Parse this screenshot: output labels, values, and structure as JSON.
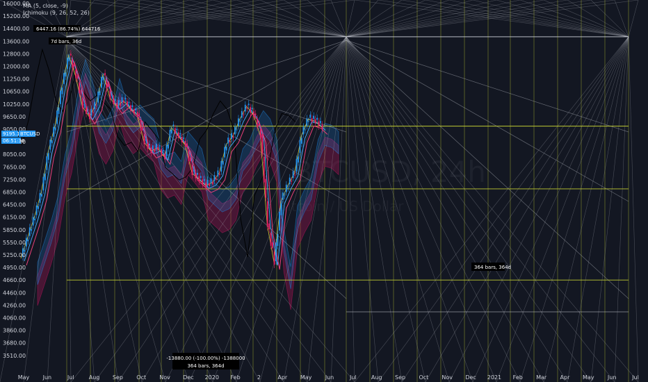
{
  "legend": {
    "ma": "MA (5, close, -9)",
    "ichimoku": "Ichimoku (9, 26, 52, 26)"
  },
  "watermark": {
    "symbol": "BTCUSD, 24h",
    "desc": "Bitcoin / US Dollar"
  },
  "price_tags": {
    "last_price": "9195.12",
    "exchange": "BTCUSD",
    "countdown": "06:51:36"
  },
  "annotations": {
    "top_label": "6447.16 (86.74%) 644716",
    "top_bars": "7d bars, 36d",
    "mid_bars": "364 bars, 364d",
    "bottom_pct": "-13880.00 (-100.00%) -1388000",
    "bottom_bars": "364 bars, 364d"
  },
  "colors": {
    "background": "#131722",
    "candle_up": "#2196f3",
    "candle_down": "#e91e63",
    "ma_line": "#000000",
    "tenkan": "#42a5f5",
    "kijun": "#ec407a",
    "lagging": "#ffeb3b",
    "cloud_bull": "#1e88e5",
    "cloud_bear": "#ad1457",
    "gann_lines": "#b2b5be",
    "fib_lines": "#c0ca33",
    "last_price_tag": "#2196f3"
  },
  "chart_data": {
    "type": "candlestick",
    "title": "",
    "xlabel": "",
    "ylabel": "",
    "x_ticks": [
      "May",
      "Jun",
      "Jul",
      "Aug",
      "Sep",
      "Oct",
      "Nov",
      "Dec",
      "2020",
      "Feb",
      "2",
      "Apr",
      "May",
      "Jun",
      "Jul",
      "Aug",
      "Sep",
      "Oct",
      "Nov",
      "Dec",
      "2021",
      "Feb",
      "Mar",
      "Apr",
      "May",
      "Jun",
      "Jul"
    ],
    "y_ticks": [
      16000,
      15200,
      14400,
      13600,
      12800,
      12000,
      11250,
      10650,
      10250,
      9650,
      9050,
      8450,
      8050,
      7650,
      7250,
      6850,
      6450,
      6150,
      5850,
      5550,
      5250,
      4950,
      4660,
      4460,
      4260,
      4060,
      3860,
      3680,
      3510
    ],
    "ylim": [
      3400,
      16000
    ],
    "horizontal_levels": [
      13880,
      9195,
      6950,
      4660
    ],
    "series": [
      {
        "name": "BTCUSD",
        "points": [
          [
            "May",
            5200
          ],
          [
            "May",
            5700
          ],
          [
            "May",
            6200
          ],
          [
            "Jun",
            6900
          ],
          [
            "Jun",
            8200
          ],
          [
            "Jun",
            9300
          ],
          [
            "Jun",
            11000
          ],
          [
            "Jul",
            12800
          ],
          [
            "Jul",
            11500
          ],
          [
            "Jul",
            10200
          ],
          [
            "Jul",
            9700
          ],
          [
            "Aug",
            10300
          ],
          [
            "Aug",
            11600
          ],
          [
            "Aug",
            10500
          ],
          [
            "Aug",
            10200
          ],
          [
            "Sep",
            10400
          ],
          [
            "Sep",
            10100
          ],
          [
            "Sep",
            9800
          ],
          [
            "Sep",
            8500
          ],
          [
            "Oct",
            8200
          ],
          [
            "Oct",
            8300
          ],
          [
            "Oct",
            8000
          ],
          [
            "Nov",
            9200
          ],
          [
            "Nov",
            8800
          ],
          [
            "Nov",
            8400
          ],
          [
            "Nov",
            7500
          ],
          [
            "Dec",
            7300
          ],
          [
            "Dec",
            7100
          ],
          [
            "Dec",
            7200
          ],
          [
            "2020",
            7500
          ],
          [
            "2020",
            8400
          ],
          [
            "2020",
            8800
          ],
          [
            "Feb",
            9600
          ],
          [
            "Feb",
            10200
          ],
          [
            "Feb",
            9800
          ],
          [
            "2",
            8800
          ],
          [
            "2",
            6000
          ],
          [
            "2",
            5100
          ],
          [
            "Apr",
            6600
          ],
          [
            "Apr",
            7100
          ],
          [
            "Apr",
            7500
          ],
          [
            "May",
            8800
          ],
          [
            "May",
            9600
          ],
          [
            "May",
            9500
          ],
          [
            "May",
            9200
          ]
        ]
      }
    ]
  }
}
